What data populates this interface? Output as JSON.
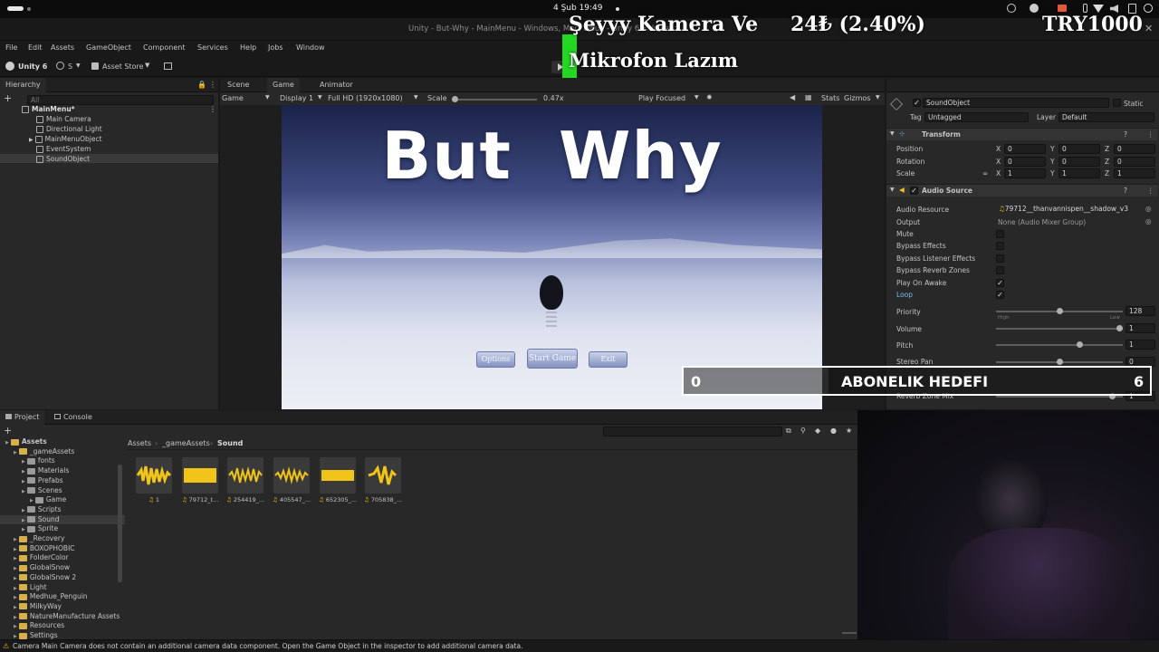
{
  "os_bar": {
    "date_time": "4 Şub  19:49"
  },
  "window": {
    "title": "Unity - But-Why - MainMenu - Windows, Mac, Linux - Unity 6 <Vulkan>"
  },
  "menu": [
    "File",
    "Edit",
    "Assets",
    "GameObject",
    "Component",
    "Services",
    "Help",
    "Jobs",
    "Window"
  ],
  "toolbar": {
    "unity_label": "Unity 6",
    "account_label": "S",
    "asset_store_label": "Asset Store"
  },
  "overlay": {
    "line1": "Şeyyy Kamera Ve",
    "line2": "Mikrofon Lazım",
    "price": "24₺ (2.40%)",
    "ticker": "TRY1000",
    "goal_start": "0",
    "goal_label": "ABONELIK HEDEFI",
    "goal_end": "6"
  },
  "hierarchy": {
    "tab": "Hierarchy",
    "search_placeholder": "All",
    "scene": "MainMenu*",
    "items": [
      "Main Camera",
      "Directional Light",
      "MainMenuObject",
      "EventSystem",
      "SoundObject"
    ]
  },
  "game_view": {
    "tabs": [
      "Scene",
      "Game",
      "Animator"
    ],
    "mode": "Game",
    "display": "Display 1",
    "resolution": "Full HD (1920x1080)",
    "scale_label": "Scale",
    "scale_value": "0.47x",
    "play_mode": "Play Focused",
    "stats": "Stats",
    "gizmos": "Gizmos",
    "game_title": "But  Why",
    "buttons": [
      "Options",
      "Start Game",
      "Exit"
    ]
  },
  "inspector": {
    "object_name": "SoundObject",
    "static_label": "Static",
    "tag_label": "Tag",
    "tag_value": "Untagged",
    "layer_label": "Layer",
    "layer_value": "Default",
    "transform": {
      "title": "Transform",
      "rows": [
        {
          "label": "Position",
          "x": "0",
          "y": "0",
          "z": "0"
        },
        {
          "label": "Rotation",
          "x": "0",
          "y": "0",
          "z": "0"
        },
        {
          "label": "Scale",
          "x": "1",
          "y": "1",
          "z": "1"
        }
      ]
    },
    "audio": {
      "title": "Audio Source",
      "resource_label": "Audio Resource",
      "resource_value": "79712__thanvannispen__shadow_v3",
      "output_label": "Output",
      "output_value": "None (Audio Mixer Group)",
      "toggles": [
        {
          "label": "Mute",
          "checked": false
        },
        {
          "label": "Bypass Effects",
          "checked": false
        },
        {
          "label": "Bypass Listener Effects",
          "checked": false
        },
        {
          "label": "Bypass Reverb Zones",
          "checked": false
        },
        {
          "label": "Play On Awake",
          "checked": true
        },
        {
          "label": "Loop",
          "checked": true
        }
      ],
      "priority_label": "Priority",
      "priority_value": "128",
      "priority_level": 0.5,
      "priority_high": "High",
      "priority_low": "Low",
      "volume_label": "Volume",
      "volume_value": "1",
      "volume_level": 1.0,
      "pitch_label": "Pitch",
      "pitch_value": "1",
      "pitch_level": 0.67,
      "stereo_label": "Stereo Pan",
      "stereo_value": "0",
      "stereo_level": 0.5,
      "reverb_label": "Reverb Zone Mix",
      "reverb_value": "1"
    }
  },
  "project": {
    "tabs": [
      "Project",
      "Console"
    ],
    "breadcrumb": [
      "Assets",
      "_gameAssets",
      "Sound"
    ],
    "tree": [
      {
        "label": "Assets",
        "depth": 0,
        "bold": true
      },
      {
        "label": "_gameAssets",
        "depth": 1
      },
      {
        "label": "fonts",
        "depth": 2
      },
      {
        "label": "Materials",
        "depth": 2
      },
      {
        "label": "Prefabs",
        "depth": 2
      },
      {
        "label": "Scenes",
        "depth": 2
      },
      {
        "label": "Game",
        "depth": 3
      },
      {
        "label": "Scripts",
        "depth": 2
      },
      {
        "label": "Sound",
        "depth": 2,
        "selected": true
      },
      {
        "label": "Sprite",
        "depth": 2
      },
      {
        "label": "_Recovery",
        "depth": 1
      },
      {
        "label": "BOXOPHOBIC",
        "depth": 1
      },
      {
        "label": "FolderColor",
        "depth": 1
      },
      {
        "label": "GlobalSnow",
        "depth": 1
      },
      {
        "label": "GlobalSnow 2",
        "depth": 1
      },
      {
        "label": "Light",
        "depth": 1
      },
      {
        "label": "Medhue_Penguin",
        "depth": 1
      },
      {
        "label": "MilkyWay",
        "depth": 1
      },
      {
        "label": "NatureManufacture Assets",
        "depth": 1
      },
      {
        "label": "Resources",
        "depth": 1
      },
      {
        "label": "Settings",
        "depth": 1
      }
    ],
    "assets": [
      "1",
      "79712_t...",
      "254419_...",
      "405547_...",
      "652305_...",
      "705838_..."
    ]
  },
  "status": {
    "message": "Camera Main Camera does not contain an additional camera data component. Open the Game Object in the inspector to add additional camera data."
  },
  "colors": {
    "overlay_green": "#22d822",
    "overlay_gold": "#f2b632",
    "audio_yellow": "#f0c419",
    "warning": "#f0b020"
  }
}
